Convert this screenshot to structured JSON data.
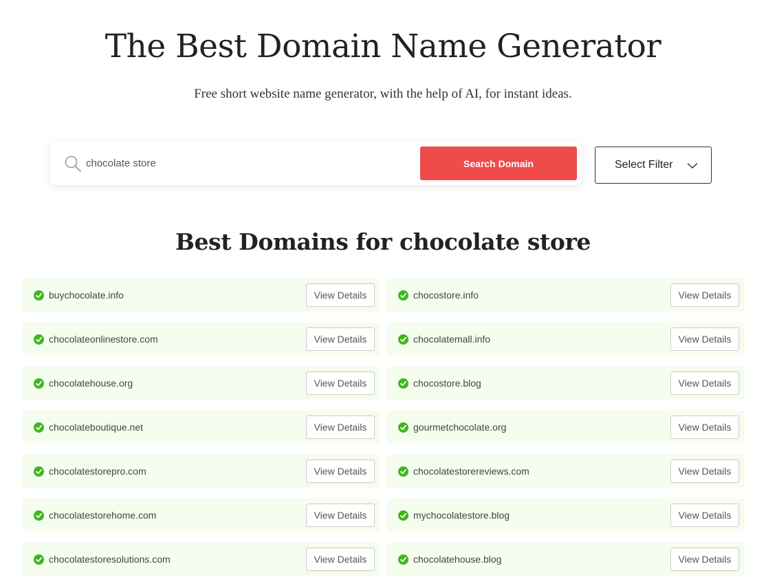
{
  "hero": {
    "title": "The Best Domain Name Generator",
    "subtitle": "Free short website name generator, with the help of AI, for instant ideas."
  },
  "search": {
    "value": "chocolate store",
    "button_label": "Search Domain",
    "icon": "search-icon",
    "button_color": "#ef4b4b"
  },
  "filter": {
    "label": "Select Filter",
    "icon": "chevron-down-icon"
  },
  "results": {
    "heading_prefix": "Best Domains for ",
    "heading_query": "chocolate store",
    "view_label": "View Details",
    "status_icon": "check-circle-icon",
    "status_color": "#3fb620",
    "row_bg": "#f4fdee",
    "left": [
      "buychocolate.info",
      "chocolateonlinestore.com",
      "chocolatehouse.org",
      "chocolateboutique.net",
      "chocolatestorepro.com",
      "chocolatestorehome.com",
      "chocolatestoresolutions.com"
    ],
    "right": [
      "chocostore.info",
      "chocolatemall.info",
      "chocostore.blog",
      "gourmetchocolate.org",
      "chocolatestorereviews.com",
      "mychocolatestore.blog",
      "chocolatehouse.blog"
    ]
  }
}
